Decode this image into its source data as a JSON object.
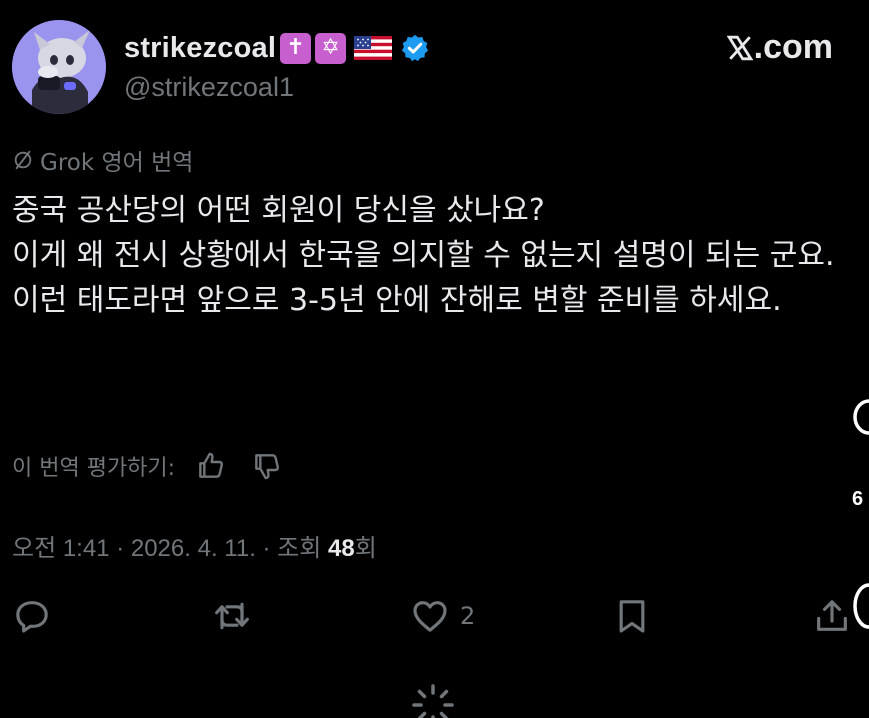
{
  "header": {
    "display_name": "strikezcoal",
    "emoji_cross": "✝",
    "emoji_star": "✡",
    "flag_icon": "us-flag-icon",
    "verified_icon": "verified-badge-icon",
    "handle": "@strikezcoal1",
    "site_x": "𝕏",
    "site_suffix": ".com"
  },
  "translation": {
    "label": "Grok 영어 번역",
    "icon": "grok-slash-icon"
  },
  "body_lines": [
    "중국 공산당의 어떤 회원이 당신을 샀나요?",
    "이게 왜 전시 상황에서 한국을 의지할 수 없는지 설명이 되는 군요.",
    "이런 태도라면 앞으로 3-5년 안에 잔해로 변할 준비를 하세요."
  ],
  "rating": {
    "label": "이 번역 평가하기:",
    "up_icon": "thumbs-up-icon",
    "down_icon": "thumbs-down-icon"
  },
  "meta": {
    "time_date": "오전 1:41 · 2026. 4. 11. · 조회 ",
    "views": "48",
    "views_suffix": "회"
  },
  "actions": {
    "reply_icon": "reply-icon",
    "repost_icon": "repost-icon",
    "like_icon": "heart-icon",
    "like_count": "2",
    "bookmark_icon": "bookmark-icon",
    "share_icon": "share-icon"
  },
  "edge_fragments": {
    "six": "6"
  },
  "colors": {
    "background": "#000000",
    "text": "#e7e9ea",
    "muted": "#71767b",
    "verified": "#1d9bf0",
    "emoji_bg": "#c85fcf"
  }
}
